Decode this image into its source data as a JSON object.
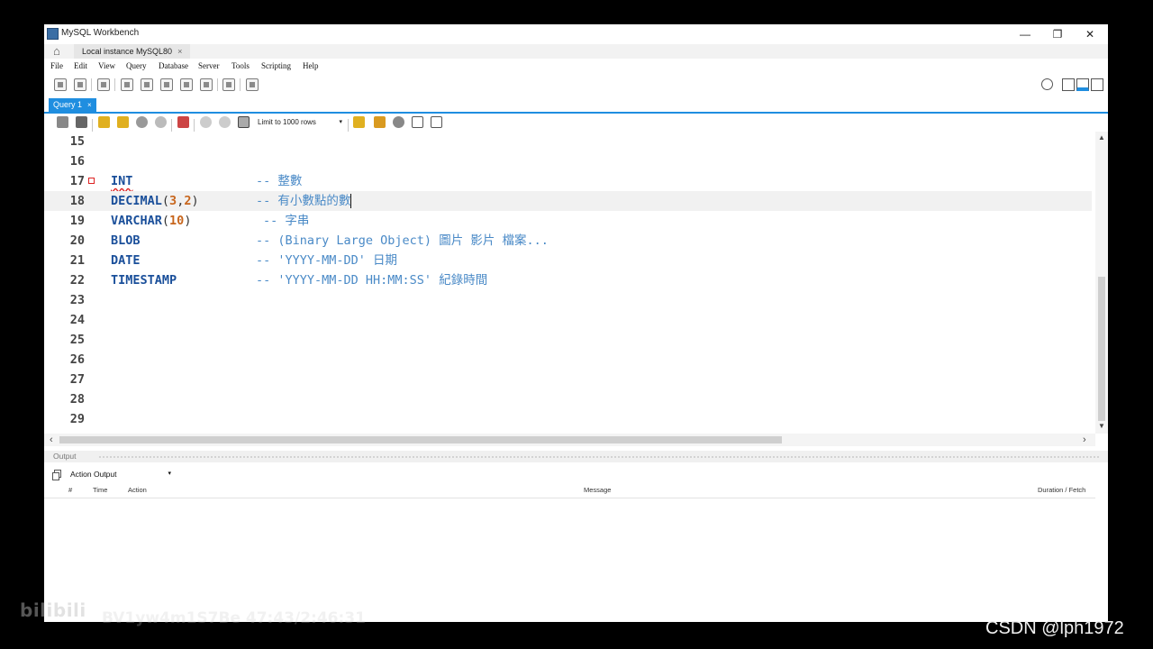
{
  "window": {
    "title": "MySQL Workbench",
    "controls": {
      "minimize": "—",
      "restore": "❐",
      "close": "✕"
    }
  },
  "connection_tab": {
    "label": "Local instance MySQL80",
    "close": "×"
  },
  "menu": [
    "File",
    "Edit",
    "View",
    "Query",
    "Database",
    "Server",
    "Tools",
    "Scripting",
    "Help"
  ],
  "query_tab": {
    "label": "Query 1",
    "close": "×"
  },
  "sql_toolbar": {
    "limit_label": "Limit to 1000 rows",
    "dropdown": "▾"
  },
  "editor": {
    "lines": [
      {
        "num": "15"
      },
      {
        "num": "16"
      },
      {
        "num": "17",
        "kw": "INT",
        "comment": "-- 整數"
      },
      {
        "num": "18",
        "kw": "DECIMAL",
        "args": [
          "3",
          "2"
        ],
        "comment_prefix": "-- ",
        "comment_text": "有小數點的數"
      },
      {
        "num": "19",
        "kw": "VARCHAR",
        "args": [
          "10"
        ],
        "comment": "-- 字串"
      },
      {
        "num": "20",
        "kw": "BLOB",
        "comment": "-- (Binary Large Object) 圖片 影片 檔案..."
      },
      {
        "num": "21",
        "kw": "DATE",
        "comment": "-- 'YYYY-MM-DD' 日期"
      },
      {
        "num": "22",
        "kw": "TIMESTAMP",
        "comment": "-- 'YYYY-MM-DD HH:MM:SS' 紀錄時間"
      },
      {
        "num": "23"
      },
      {
        "num": "24"
      },
      {
        "num": "25"
      },
      {
        "num": "26"
      },
      {
        "num": "27"
      },
      {
        "num": "28"
      },
      {
        "num": "29"
      }
    ]
  },
  "output": {
    "title": "Output",
    "selector": "Action Output",
    "columns": {
      "index": "#",
      "time": "Time",
      "action": "Action",
      "message": "Message",
      "duration": "Duration / Fetch"
    }
  },
  "overlay": {
    "watermark": "bilibili",
    "video_id": "BV1yw4m1S7Be 47:43/2:46:31",
    "credit": "CSDN @lph1972"
  },
  "colors": {
    "accent": "#1f8ee0",
    "keyword": "#1a4f9a",
    "number": "#c7651c",
    "comment": "#4a8ac7",
    "error_marker": "#dd2222"
  }
}
